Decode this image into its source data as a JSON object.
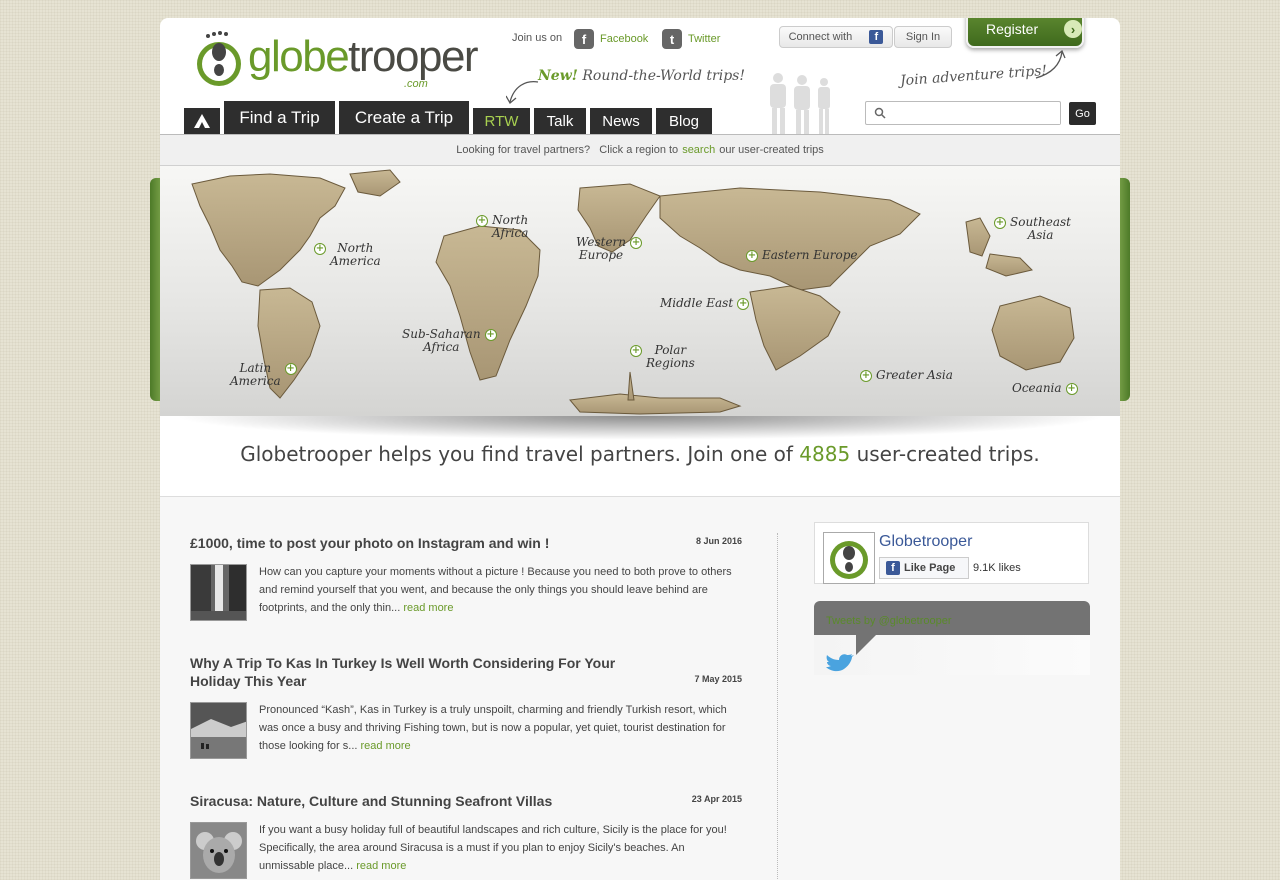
{
  "brand": {
    "name_prefix": "globe",
    "name_suffix": "trooper",
    "domain": ".com"
  },
  "header": {
    "join_text": "Join us on",
    "facebook_label": "Facebook",
    "twitter_label": "Twitter",
    "connect_label": "Connect with",
    "signin_label": "Sign In",
    "register_label": "Register",
    "rtw_new": "New!",
    "rtw_note": "Round-the-World trips!",
    "adventure_note": "Join adventure trips!",
    "search_placeholder": "",
    "go_label": "Go"
  },
  "nav": {
    "home": "home-icon",
    "items": [
      {
        "label": "Find a Trip"
      },
      {
        "label": "Create a Trip"
      },
      {
        "label": "RTW"
      },
      {
        "label": "Talk"
      },
      {
        "label": "News"
      },
      {
        "label": "Blog"
      }
    ]
  },
  "notice": {
    "prefix": "Looking for travel partners?   Click a region to",
    "link": "search",
    "suffix": "our user-created trips"
  },
  "map": {
    "regions": [
      {
        "line1": "North",
        "line2": "America"
      },
      {
        "line1": "North",
        "line2": "Africa"
      },
      {
        "line1": "Western",
        "line2": "Europe"
      },
      {
        "line1": "Eastern Europe",
        "line2": ""
      },
      {
        "line1": "Southeast",
        "line2": "Asia"
      },
      {
        "line1": "Middle East",
        "line2": ""
      },
      {
        "line1": "Sub-Saharan",
        "line2": "Africa"
      },
      {
        "line1": "Polar",
        "line2": "Regions"
      },
      {
        "line1": "Latin",
        "line2": "America"
      },
      {
        "line1": "Greater Asia",
        "line2": ""
      },
      {
        "line1": "Oceania",
        "line2": ""
      }
    ]
  },
  "tagline": {
    "prefix": "Globetrooper helps you find travel partners. Join one of",
    "count": "4885",
    "suffix": "user-created trips."
  },
  "articles": [
    {
      "title": "£1000, time to post your photo on Instagram and win !",
      "date": "8 Jun 2016",
      "excerpt": "How can you capture your moments without a picture ! Because you need to both prove to others and remind yourself that you went, and because the only things you should leave behind are footprints, and the only thin...",
      "more": "read more"
    },
    {
      "title": "Why A Trip To Kas In Turkey Is Well Worth Considering For Your Holiday This Year",
      "date": "7 May 2015",
      "excerpt": "Pronounced “Kash”, Kas in Turkey is a truly unspoilt, charming and friendly Turkish resort, which was once a busy and thriving Fishing town, but is now a popular, yet quiet, tourist destination for those looking for s...",
      "more": "read more"
    },
    {
      "title": "Siracusa: Nature, Culture and Stunning Seafront Villas",
      "date": "23 Apr 2015",
      "excerpt": "If you want a busy holiday full of beautiful landscapes and rich culture, Sicily is the place for you! Specifically, the area around Siracusa is a must if you plan to enjoy Sicily's beaches. An unmissable place...",
      "more": "read more"
    }
  ],
  "facebook_widget": {
    "name": "Globetrooper",
    "like_label": "Like Page",
    "likes": "9.1K likes"
  },
  "twitter_widget": {
    "link": "Tweets by @globetrooper"
  },
  "colors": {
    "accent": "#6a9a2a",
    "nav": "#2e2e2e",
    "facebook": "#3b5998"
  }
}
